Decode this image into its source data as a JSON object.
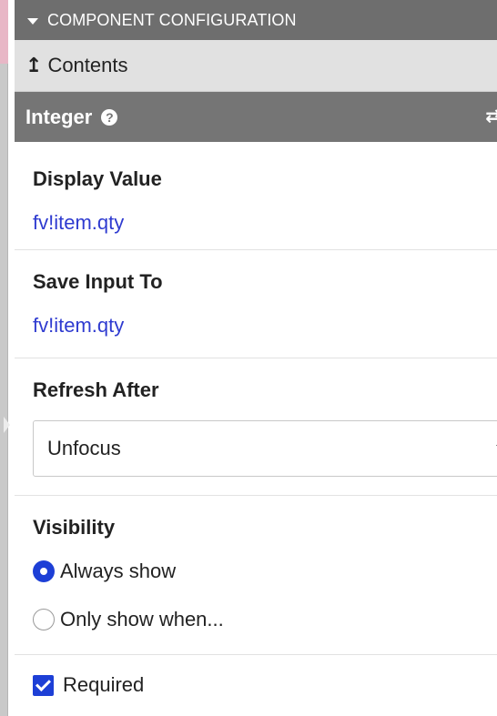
{
  "header": {
    "title": "COMPONENT CONFIGURATION"
  },
  "breadcrumb": {
    "icon": "arrow-up-icon",
    "label": "Contents"
  },
  "component": {
    "type": "Integer",
    "help_icon": "question-circle-icon"
  },
  "display_value": {
    "label": "Display Value",
    "value": "fv!item.qty"
  },
  "save_input": {
    "label": "Save Input To",
    "value": "fv!item.qty"
  },
  "refresh_after": {
    "label": "Refresh After",
    "selected": "Unfocus"
  },
  "visibility": {
    "label": "Visibility",
    "options": [
      {
        "label": "Always show",
        "selected": true
      },
      {
        "label": "Only show when...",
        "selected": false
      }
    ]
  },
  "required": {
    "label": "Required",
    "checked": true
  },
  "colors": {
    "accent": "#1d3fd6",
    "link": "#2f3bd0",
    "header_bg": "#6e6e6e",
    "breadcrumb_bg": "#e1e1e1"
  }
}
